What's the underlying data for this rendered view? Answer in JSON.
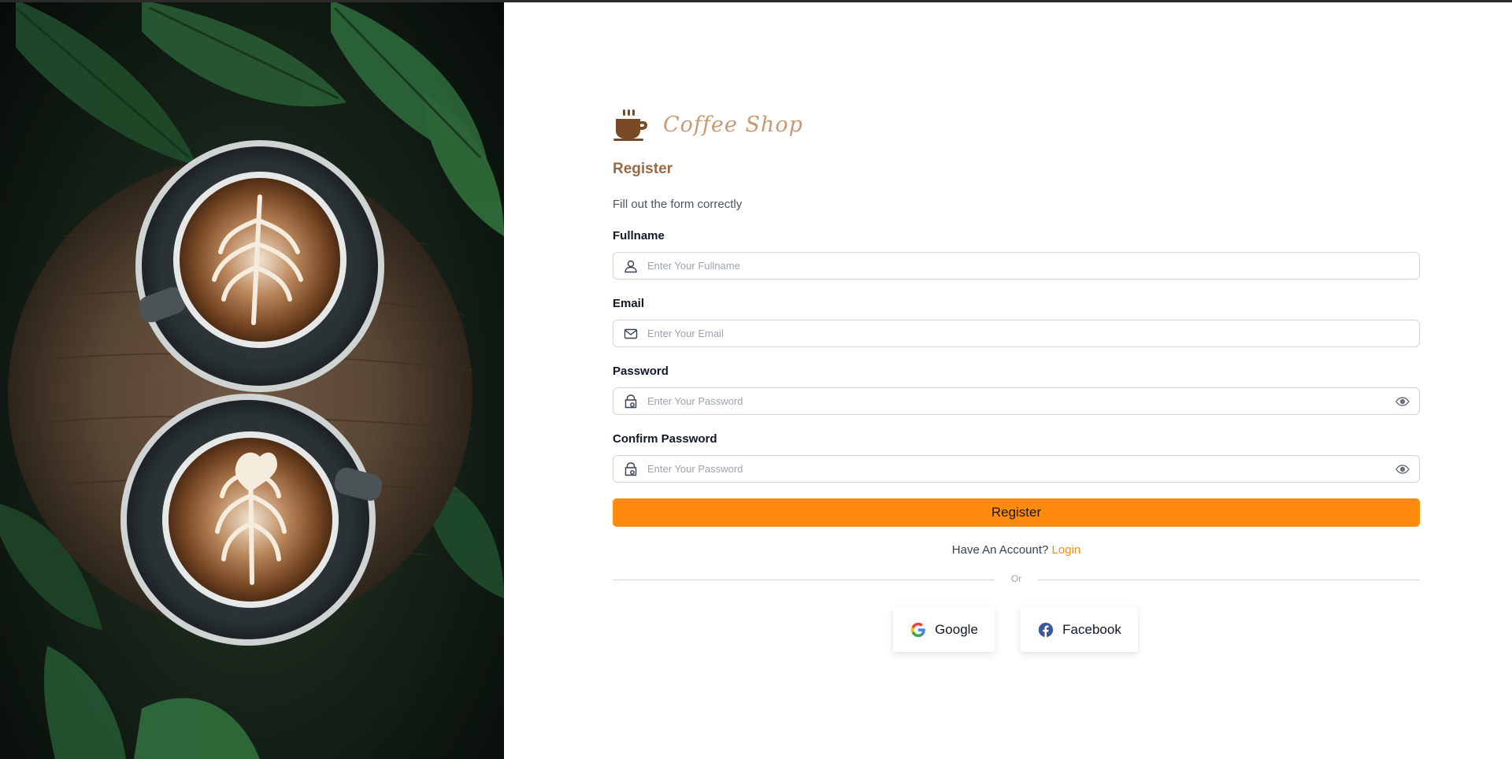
{
  "brand": {
    "name": "Coffee Shop",
    "logo_icon": "coffee-cup-icon"
  },
  "form": {
    "title": "Register",
    "subtitle": "Fill out the form correctly",
    "fields": [
      {
        "label": "Fullname",
        "placeholder": "Enter Your Fullname",
        "icon": "user-icon"
      },
      {
        "label": "Email",
        "placeholder": "Enter Your Email",
        "icon": "mail-icon"
      },
      {
        "label": "Password",
        "placeholder": "Enter Your Password",
        "icon": "lock-icon",
        "toggle_icon": "eye-icon"
      },
      {
        "label": "Confirm Password",
        "placeholder": "Enter Your Password",
        "icon": "lock-icon",
        "toggle_icon": "eye-icon"
      }
    ],
    "submit_label": "Register",
    "account_prompt": "Have An Account?",
    "login_link": "Login",
    "divider_text": "Or",
    "social": [
      {
        "label": "Google",
        "icon": "google-icon"
      },
      {
        "label": "Facebook",
        "icon": "facebook-icon"
      }
    ]
  },
  "colors": {
    "accent": "#ff8a0c",
    "title": "#9b6a43",
    "brand_text": "#c79a73",
    "border": "#d1d5db"
  },
  "hero_image": {
    "subject": "two-latte-cups-on-wooden-table"
  }
}
